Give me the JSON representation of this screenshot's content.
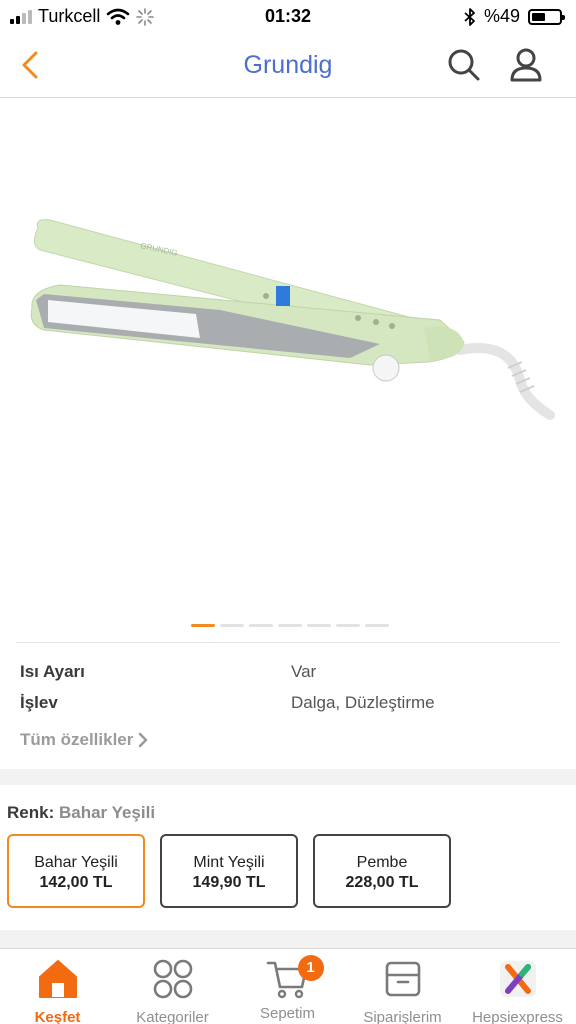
{
  "status_bar": {
    "carrier": "Turkcell",
    "time": "01:32",
    "battery": "%49",
    "battery_level": 0.49
  },
  "nav": {
    "title": "Grundig"
  },
  "product": {
    "image_desc_icon": "hair-straightener",
    "carousel": {
      "count": 7,
      "active": 0
    }
  },
  "specs": [
    {
      "label": "Isı Ayarı",
      "value": "Var"
    },
    {
      "label": "İşlev",
      "value": "Dalga, Düzleştirme"
    }
  ],
  "all_specs_link": "Tüm özellikler",
  "color": {
    "label": "Renk:",
    "selected": "Bahar Yeşili",
    "variants": [
      {
        "name": "Bahar Yeşili",
        "price": "142,00 TL",
        "selected": true
      },
      {
        "name": "Mint Yeşili",
        "price": "149,90 TL",
        "selected": false
      },
      {
        "name": "Pembe",
        "price": "228,00 TL",
        "selected": false
      }
    ]
  },
  "tabs": [
    {
      "label": "Keşfet",
      "icon": "home-icon",
      "active": true
    },
    {
      "label": "Kategoriler",
      "icon": "grid-icon",
      "active": false
    },
    {
      "label": "Sepetim",
      "icon": "cart-icon",
      "active": false,
      "badge": "1"
    },
    {
      "label": "Siparişlerim",
      "icon": "box-icon",
      "active": false
    },
    {
      "label": "Hepsiexpress",
      "icon": "hepsiexpress-logo-icon",
      "active": false
    }
  ],
  "colors": {
    "accent": "#f28b1e",
    "title": "#4b6fd0",
    "product_body": "#d9ebc6"
  }
}
